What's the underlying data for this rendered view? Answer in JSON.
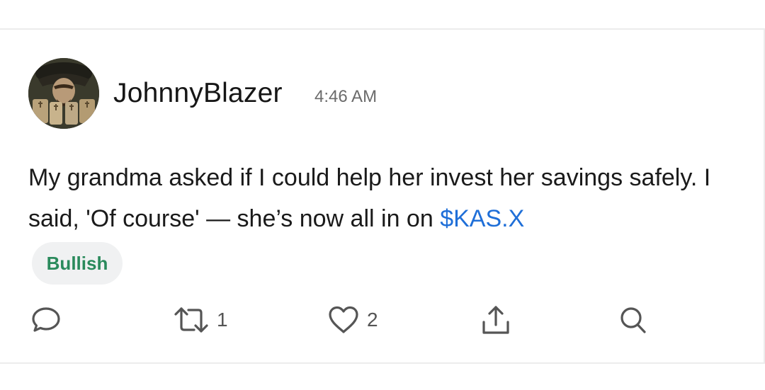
{
  "post": {
    "username": "JohnnyBlazer",
    "timestamp": "4:46 AM",
    "avatar_icon": "pirate-captain-avatar",
    "body_text": "My grandma asked if I could help her invest her savings safely. I said, 'Of course' —  she’s now all in on ",
    "cashtag": "$KAS.X",
    "sentiment": "Bullish"
  },
  "actions": {
    "reply_icon": "comment-bubble-icon",
    "repost_icon": "repost-icon",
    "repost_count": "1",
    "like_icon": "heart-icon",
    "like_count": "2",
    "share_icon": "share-upload-icon",
    "search_icon": "search-icon"
  },
  "colors": {
    "cashtag": "#1f6fd8",
    "bullish_text": "#2a8a5c",
    "badge_bg": "#f0f1f2",
    "icon": "#555555",
    "timestamp": "#6b6b6b"
  }
}
